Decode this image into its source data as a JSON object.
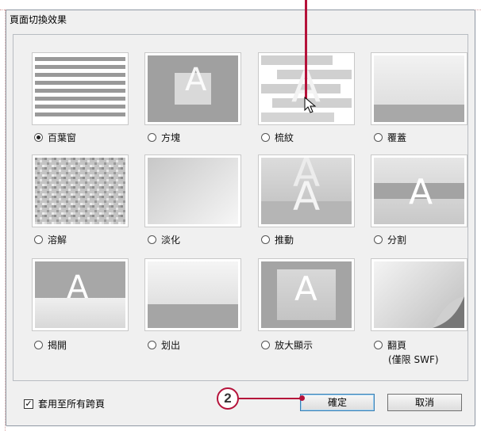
{
  "dialog": {
    "title": "頁面切換效果",
    "effects": [
      {
        "label": "百葉窗",
        "selected": true
      },
      {
        "label": "方塊",
        "selected": false
      },
      {
        "label": "梳紋",
        "selected": false
      },
      {
        "label": "覆蓋",
        "selected": false
      },
      {
        "label": "溶解",
        "selected": false
      },
      {
        "label": "淡化",
        "selected": false
      },
      {
        "label": "推動",
        "selected": false
      },
      {
        "label": "分割",
        "selected": false
      },
      {
        "label": "揭開",
        "selected": false
      },
      {
        "label": "划出",
        "selected": false
      },
      {
        "label": "放大顯示",
        "selected": false
      },
      {
        "label": "翻頁",
        "selected": false,
        "note": "(僅限 SWF)"
      }
    ],
    "apply_all_label": "套用至所有跨頁",
    "apply_all_checked": true,
    "ok_label": "確定",
    "cancel_label": "取消"
  },
  "annotations": {
    "callout_number": "2",
    "callout_color": "#b5123a"
  },
  "thumbnail_letter": "A"
}
